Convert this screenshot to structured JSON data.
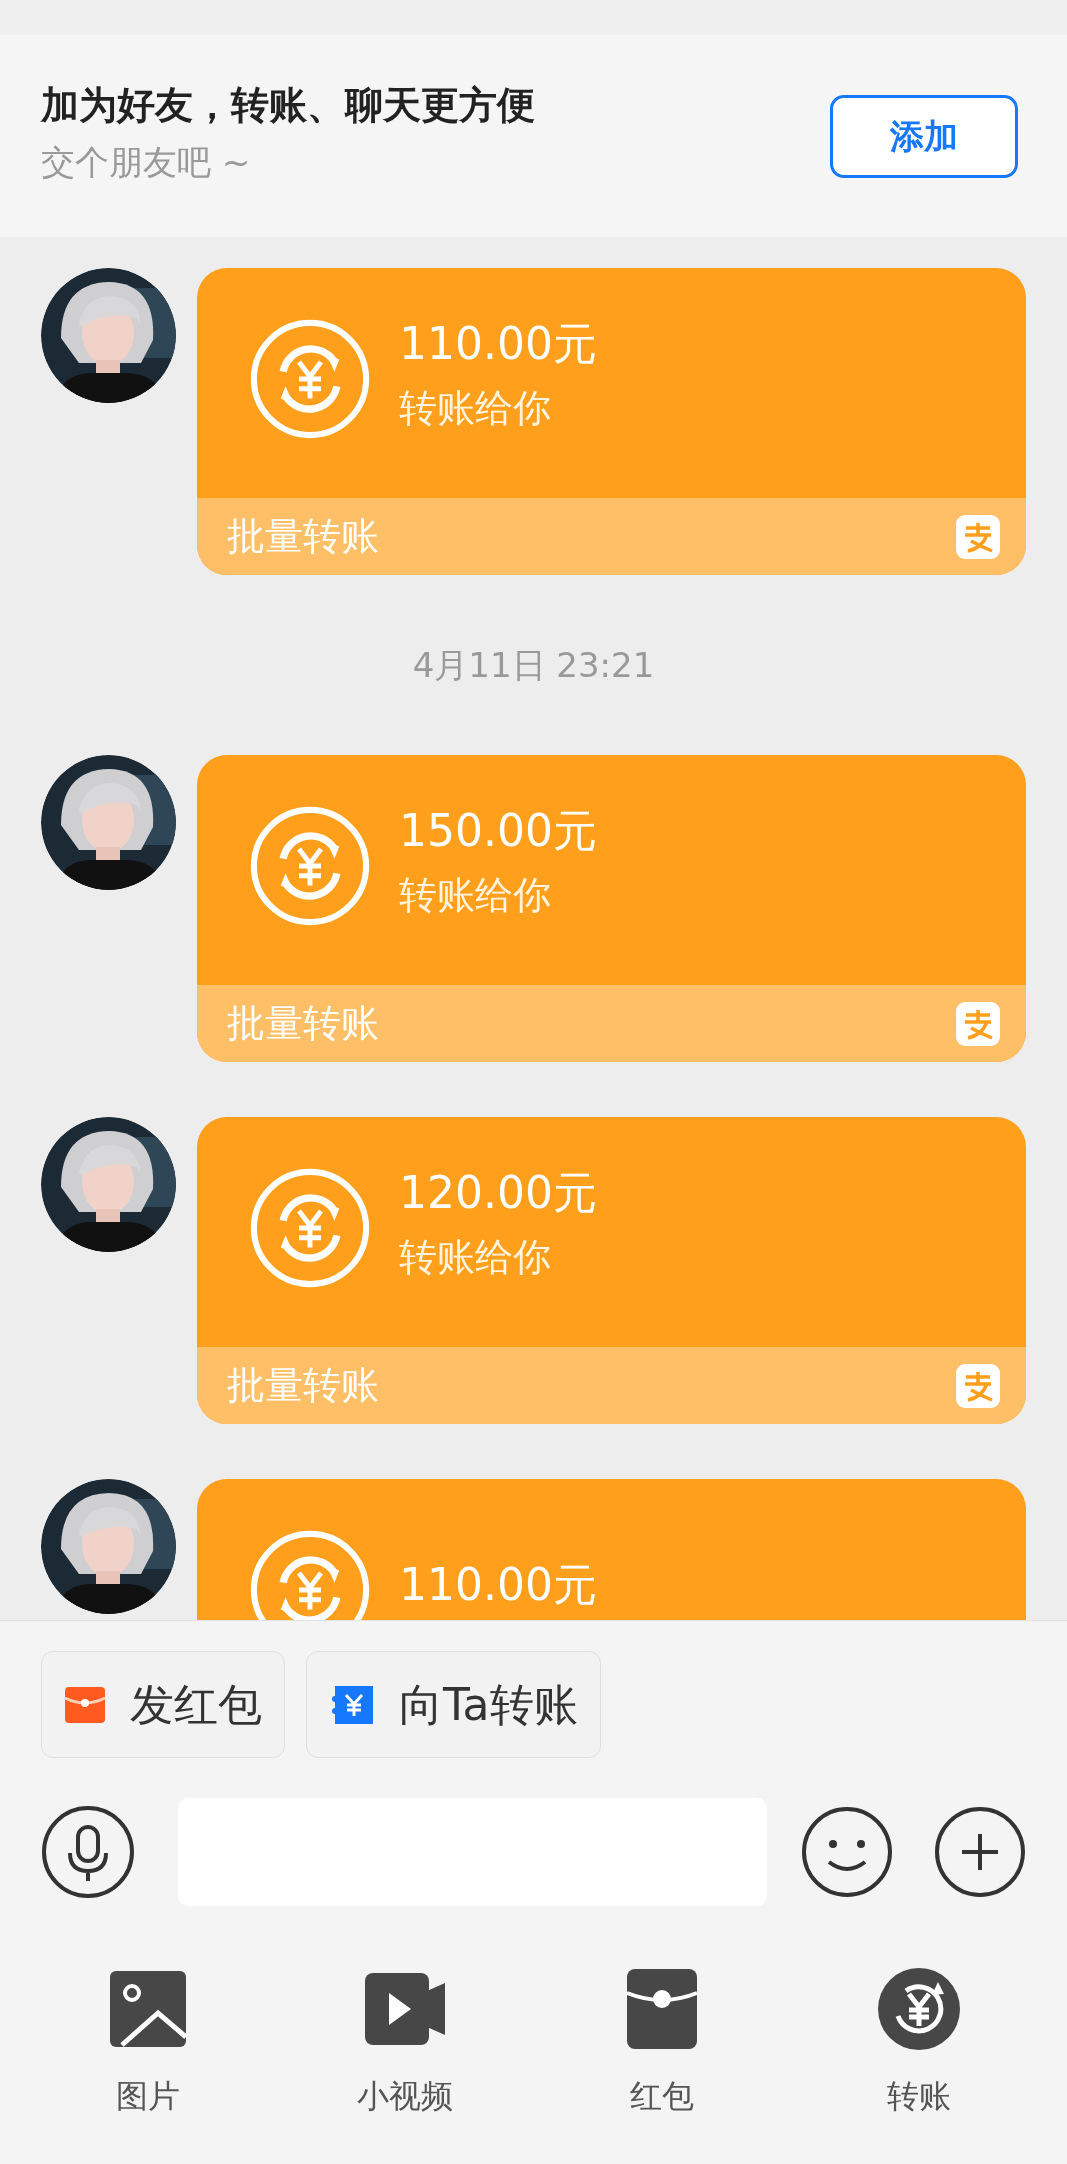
{
  "banner": {
    "title": "加为好友，转账、聊天更方便",
    "subtitle": "交个朋友吧 ~",
    "button": "添加"
  },
  "messages": [
    {
      "kind": "transfer",
      "amount": "110.00元",
      "note": "转账给你",
      "footer": "批量转账"
    },
    {
      "kind": "time",
      "text": "4月11日 23:21"
    },
    {
      "kind": "transfer",
      "amount": "150.00元",
      "note": "转账给你",
      "footer": "批量转账"
    },
    {
      "kind": "transfer",
      "amount": "120.00元",
      "note": "转账给你",
      "footer": "批量转账"
    },
    {
      "kind": "transfer",
      "amount": "110.00元"
    }
  ],
  "quick_actions": [
    {
      "kind": "red_packet",
      "label": "发红包"
    },
    {
      "kind": "transfer",
      "label": "向Ta转账"
    }
  ],
  "toolbar": [
    {
      "label": "图片"
    },
    {
      "kind": "video",
      "label": "小视频"
    },
    {
      "kind": "red_packet",
      "label": "红包"
    },
    {
      "kind": "transfer",
      "label": "转账"
    }
  ]
}
